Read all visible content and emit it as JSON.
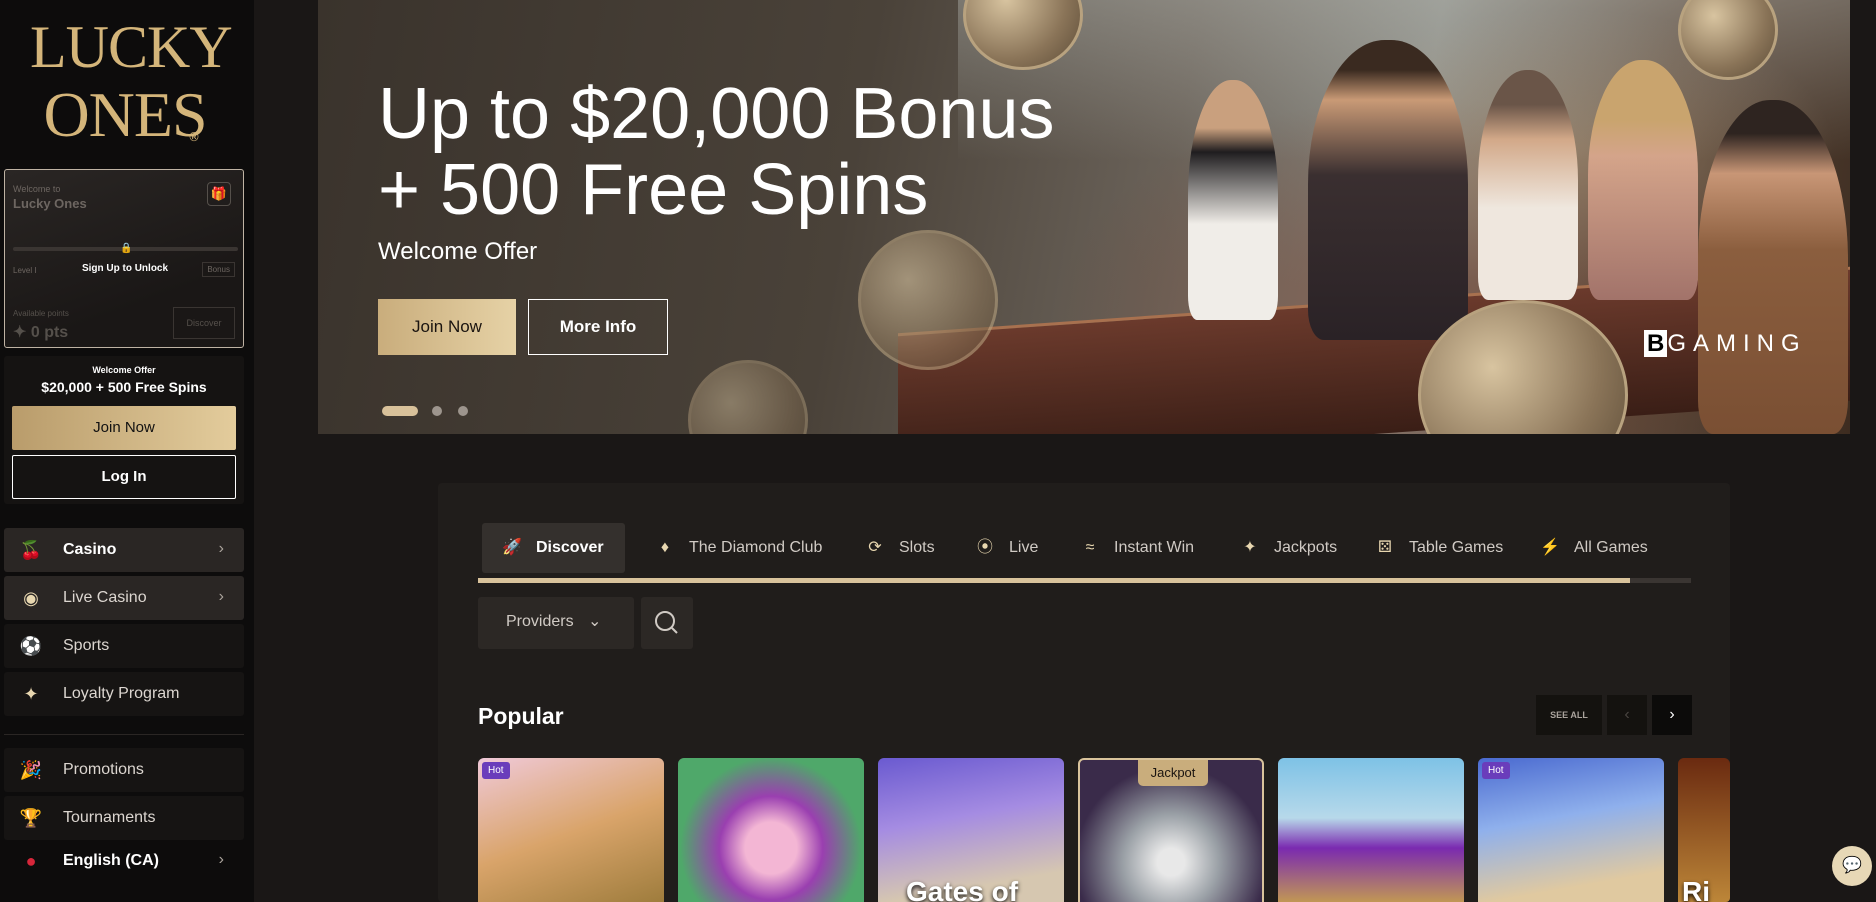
{
  "brand": {
    "logo_line1": "LUCKY",
    "logo_line2": "ONES",
    "logo_mark": "®"
  },
  "welcome_card": {
    "greeting": "Welcome to",
    "name": "Lucky Ones",
    "level": "Level I",
    "unlock_text": "Sign Up to Unlock",
    "bonus_label": "Bonus",
    "available_label": "Available points",
    "points": "0 pts",
    "points_button": "Discover"
  },
  "offer": {
    "label": "Welcome Offer",
    "headline": "$20,000 + 500 Free Spins",
    "join_label": "Join Now",
    "login_label": "Log In"
  },
  "nav": {
    "casino": "Casino",
    "live_casino": "Live Casino",
    "sports": "Sports",
    "loyalty": "Loyalty Program",
    "promotions": "Promotions",
    "tournaments": "Tournaments",
    "language": "English (CA)"
  },
  "hero": {
    "title_line1": "Up to $20,000 Bonus",
    "title_line2": "+ 500 Free Spins",
    "subtitle": "Welcome Offer",
    "join_label": "Join Now",
    "more_label": "More Info",
    "provider_mark": "B",
    "provider_rest": "GAMING",
    "active_slide": 1,
    "slide_count": 3
  },
  "tabs": [
    {
      "label": "Discover",
      "icon": "rocket-icon"
    },
    {
      "label": "The Diamond Club",
      "icon": "diamond-icon"
    },
    {
      "label": "Slots",
      "icon": "slots-icon"
    },
    {
      "label": "Live",
      "icon": "live-chip-icon"
    },
    {
      "label": "Instant Win",
      "icon": "instant-win-icon"
    },
    {
      "label": "Jackpots",
      "icon": "sparkle-icon"
    },
    {
      "label": "Table Games",
      "icon": "dice-icon"
    },
    {
      "label": "All Games",
      "icon": "lightning-icon"
    }
  ],
  "tab_scroll_progress": 0.95,
  "filters": {
    "providers_label": "Providers"
  },
  "popular": {
    "title": "Popular",
    "see_all": "SEE ALL",
    "games": [
      {
        "badge": "Hot",
        "name": ""
      },
      {
        "badge": "",
        "name": ""
      },
      {
        "badge": "",
        "name": "Gates of"
      },
      {
        "badge": "Jackpot",
        "name": ""
      },
      {
        "badge": "",
        "name": ""
      },
      {
        "badge": "Hot",
        "name": ""
      },
      {
        "badge": "",
        "name": "Ri"
      }
    ]
  },
  "colors": {
    "gold": "#d8c19a",
    "sidebar_bg": "#0d0c0c",
    "page_bg": "#1a1716",
    "hot_badge": "#6a3dbb"
  }
}
